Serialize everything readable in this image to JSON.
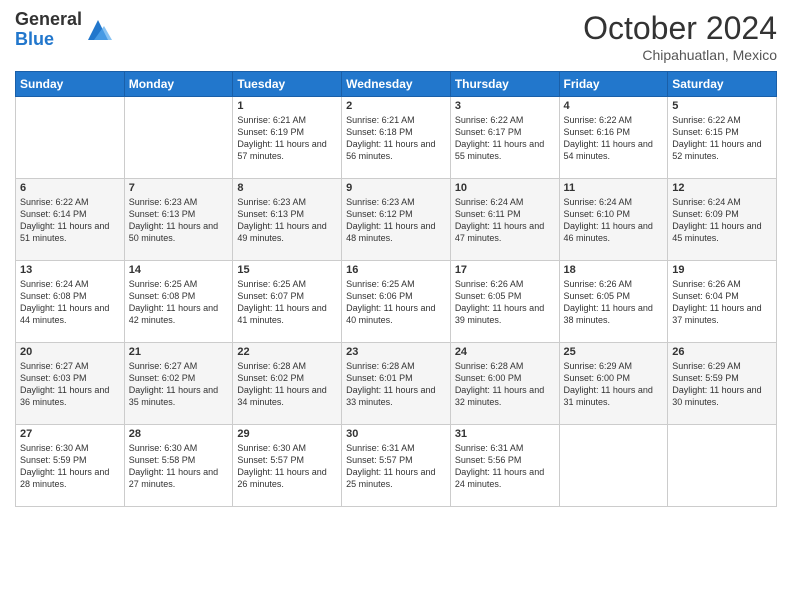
{
  "header": {
    "logo_general": "General",
    "logo_blue": "Blue",
    "month_title": "October 2024",
    "location": "Chipahuatlan, Mexico"
  },
  "weekdays": [
    "Sunday",
    "Monday",
    "Tuesday",
    "Wednesday",
    "Thursday",
    "Friday",
    "Saturday"
  ],
  "weeks": [
    [
      {
        "day": "",
        "info": ""
      },
      {
        "day": "",
        "info": ""
      },
      {
        "day": "1",
        "info": "Sunrise: 6:21 AM\nSunset: 6:19 PM\nDaylight: 11 hours and 57 minutes."
      },
      {
        "day": "2",
        "info": "Sunrise: 6:21 AM\nSunset: 6:18 PM\nDaylight: 11 hours and 56 minutes."
      },
      {
        "day": "3",
        "info": "Sunrise: 6:22 AM\nSunset: 6:17 PM\nDaylight: 11 hours and 55 minutes."
      },
      {
        "day": "4",
        "info": "Sunrise: 6:22 AM\nSunset: 6:16 PM\nDaylight: 11 hours and 54 minutes."
      },
      {
        "day": "5",
        "info": "Sunrise: 6:22 AM\nSunset: 6:15 PM\nDaylight: 11 hours and 52 minutes."
      }
    ],
    [
      {
        "day": "6",
        "info": "Sunrise: 6:22 AM\nSunset: 6:14 PM\nDaylight: 11 hours and 51 minutes."
      },
      {
        "day": "7",
        "info": "Sunrise: 6:23 AM\nSunset: 6:13 PM\nDaylight: 11 hours and 50 minutes."
      },
      {
        "day": "8",
        "info": "Sunrise: 6:23 AM\nSunset: 6:13 PM\nDaylight: 11 hours and 49 minutes."
      },
      {
        "day": "9",
        "info": "Sunrise: 6:23 AM\nSunset: 6:12 PM\nDaylight: 11 hours and 48 minutes."
      },
      {
        "day": "10",
        "info": "Sunrise: 6:24 AM\nSunset: 6:11 PM\nDaylight: 11 hours and 47 minutes."
      },
      {
        "day": "11",
        "info": "Sunrise: 6:24 AM\nSunset: 6:10 PM\nDaylight: 11 hours and 46 minutes."
      },
      {
        "day": "12",
        "info": "Sunrise: 6:24 AM\nSunset: 6:09 PM\nDaylight: 11 hours and 45 minutes."
      }
    ],
    [
      {
        "day": "13",
        "info": "Sunrise: 6:24 AM\nSunset: 6:08 PM\nDaylight: 11 hours and 44 minutes."
      },
      {
        "day": "14",
        "info": "Sunrise: 6:25 AM\nSunset: 6:08 PM\nDaylight: 11 hours and 42 minutes."
      },
      {
        "day": "15",
        "info": "Sunrise: 6:25 AM\nSunset: 6:07 PM\nDaylight: 11 hours and 41 minutes."
      },
      {
        "day": "16",
        "info": "Sunrise: 6:25 AM\nSunset: 6:06 PM\nDaylight: 11 hours and 40 minutes."
      },
      {
        "day": "17",
        "info": "Sunrise: 6:26 AM\nSunset: 6:05 PM\nDaylight: 11 hours and 39 minutes."
      },
      {
        "day": "18",
        "info": "Sunrise: 6:26 AM\nSunset: 6:05 PM\nDaylight: 11 hours and 38 minutes."
      },
      {
        "day": "19",
        "info": "Sunrise: 6:26 AM\nSunset: 6:04 PM\nDaylight: 11 hours and 37 minutes."
      }
    ],
    [
      {
        "day": "20",
        "info": "Sunrise: 6:27 AM\nSunset: 6:03 PM\nDaylight: 11 hours and 36 minutes."
      },
      {
        "day": "21",
        "info": "Sunrise: 6:27 AM\nSunset: 6:02 PM\nDaylight: 11 hours and 35 minutes."
      },
      {
        "day": "22",
        "info": "Sunrise: 6:28 AM\nSunset: 6:02 PM\nDaylight: 11 hours and 34 minutes."
      },
      {
        "day": "23",
        "info": "Sunrise: 6:28 AM\nSunset: 6:01 PM\nDaylight: 11 hours and 33 minutes."
      },
      {
        "day": "24",
        "info": "Sunrise: 6:28 AM\nSunset: 6:00 PM\nDaylight: 11 hours and 32 minutes."
      },
      {
        "day": "25",
        "info": "Sunrise: 6:29 AM\nSunset: 6:00 PM\nDaylight: 11 hours and 31 minutes."
      },
      {
        "day": "26",
        "info": "Sunrise: 6:29 AM\nSunset: 5:59 PM\nDaylight: 11 hours and 30 minutes."
      }
    ],
    [
      {
        "day": "27",
        "info": "Sunrise: 6:30 AM\nSunset: 5:59 PM\nDaylight: 11 hours and 28 minutes."
      },
      {
        "day": "28",
        "info": "Sunrise: 6:30 AM\nSunset: 5:58 PM\nDaylight: 11 hours and 27 minutes."
      },
      {
        "day": "29",
        "info": "Sunrise: 6:30 AM\nSunset: 5:57 PM\nDaylight: 11 hours and 26 minutes."
      },
      {
        "day": "30",
        "info": "Sunrise: 6:31 AM\nSunset: 5:57 PM\nDaylight: 11 hours and 25 minutes."
      },
      {
        "day": "31",
        "info": "Sunrise: 6:31 AM\nSunset: 5:56 PM\nDaylight: 11 hours and 24 minutes."
      },
      {
        "day": "",
        "info": ""
      },
      {
        "day": "",
        "info": ""
      }
    ]
  ]
}
